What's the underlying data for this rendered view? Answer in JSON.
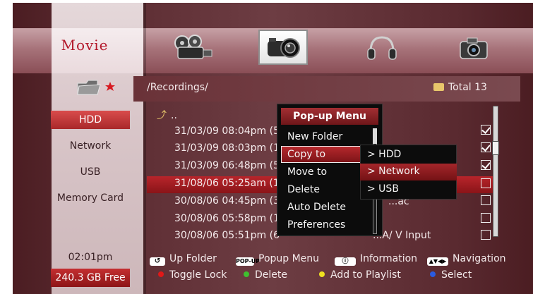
{
  "header": {
    "app_section": "Movie",
    "categories": [
      {
        "icon": "movie-reel-icon",
        "selected": false
      },
      {
        "icon": "video-camera-icon",
        "selected": true
      },
      {
        "icon": "headphones-icon",
        "selected": false
      },
      {
        "icon": "photo-camera-icon",
        "selected": false
      }
    ]
  },
  "path_bar": {
    "path": "/Recordings/",
    "total_label": "Total 13"
  },
  "sidebar": {
    "items": [
      "HDD",
      "Network",
      "USB",
      "Memory Card"
    ],
    "active_index": 0
  },
  "list": {
    "up_label": "..",
    "rows": [
      {
        "text": "31/03/09 08:04pm (5",
        "checked": true
      },
      {
        "text": "31/03/09 08:03pm (1",
        "checked": true
      },
      {
        "text": "31/03/09 06:48pm (5",
        "checked": true
      },
      {
        "text": "31/08/06 05:25am (1",
        "checked": false
      },
      {
        "text": "30/08/06 04:45pm (3",
        "checked": false
      },
      {
        "text": "30/08/06 05:58pm (1",
        "checked": false
      },
      {
        "text": "30/08/06 05:51pm (6",
        "checked": false
      }
    ],
    "selected_index": 3,
    "partial_text_row4": "...ac",
    "partial_text_row6": "...A/ V Input"
  },
  "popup_menu": {
    "title": "Pop-up Menu",
    "items": [
      "New Folder",
      "Copy to",
      "Move to",
      "Delete",
      "Auto Delete",
      "Preferences"
    ],
    "highlighted_index": 1
  },
  "submenu": {
    "items": [
      "> HDD",
      "> Network",
      "> USB"
    ],
    "highlighted_index": 1
  },
  "footer": {
    "time": "02:01pm",
    "free_space": "240.3 GB Free",
    "hints": {
      "up_folder": "Up Folder",
      "popup_menu": "Popup Menu",
      "popup_key": "POP-UP",
      "information": "Information",
      "navigation": "Navigation",
      "toggle_lock": "Toggle Lock",
      "delete": "Delete",
      "add_to_playlist": "Add to Playlist",
      "select": "Select"
    }
  },
  "colors": {
    "accent_red": "#b3182a",
    "highlight_red": "#a9282a",
    "red_dot": "#e01818",
    "green_dot": "#3fbf2f",
    "yellow_dot": "#f0e020",
    "blue_dot": "#2a5be0"
  }
}
